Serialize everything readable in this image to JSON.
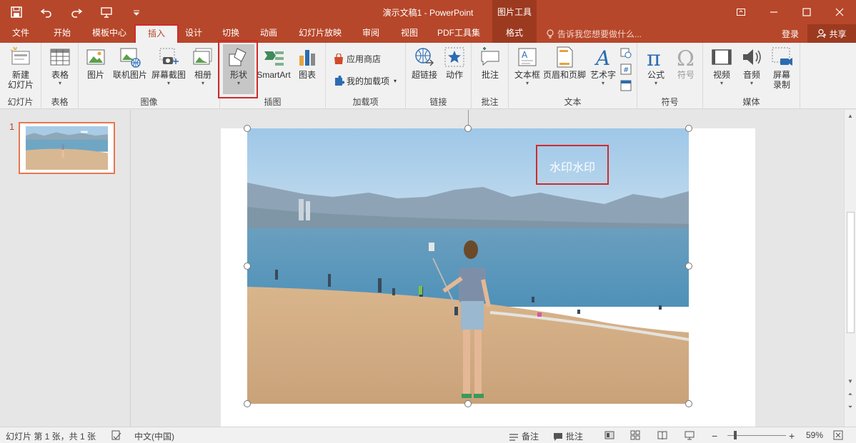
{
  "window": {
    "title": "演示文稿1 - PowerPoint",
    "context_header": "图片工具"
  },
  "qat": {
    "icons": [
      "save-icon",
      "undo-icon",
      "redo-icon",
      "present-icon",
      "customize-icon"
    ]
  },
  "tabs": [
    {
      "label": "文件"
    },
    {
      "label": "开始"
    },
    {
      "label": "模板中心"
    },
    {
      "label": "插入",
      "active": true
    },
    {
      "label": "设计"
    },
    {
      "label": "切换"
    },
    {
      "label": "动画"
    },
    {
      "label": "幻灯片放映"
    },
    {
      "label": "审阅"
    },
    {
      "label": "视图"
    },
    {
      "label": "PDF工具集"
    },
    {
      "label": "格式"
    }
  ],
  "tell_me": "告诉我您想要做什么...",
  "account": {
    "login": "登录",
    "share": "共享"
  },
  "ribbon": {
    "groups": {
      "slides": "幻灯片",
      "tables": "表格",
      "images": "图像",
      "illustrations": "插图",
      "addins": "加载项",
      "links": "链接",
      "comments": "批注",
      "text": "文本",
      "symbols": "符号",
      "media": "媒体"
    },
    "buttons": {
      "new_slide_1": "新建",
      "new_slide_2": "幻灯片",
      "table": "表格",
      "picture": "图片",
      "online_picture": "联机图片",
      "screenshot": "屏幕截图",
      "album": "相册",
      "shapes": "形状",
      "smartart": "SmartArt",
      "chart": "图表",
      "store": "应用商店",
      "my_addins": "我的加载项",
      "hyperlink": "超链接",
      "action": "动作",
      "comment": "批注",
      "textbox": "文本框",
      "header_footer": "页眉和页脚",
      "wordart": "艺术字",
      "equation": "公式",
      "symbol": "符号",
      "video": "视频",
      "audio": "音频",
      "screen_rec_1": "屏幕",
      "screen_rec_2": "录制"
    }
  },
  "thumbnails": {
    "slide_number": "1"
  },
  "slide": {
    "watermark_text": "水印水印"
  },
  "statusbar": {
    "slide_info": "幻灯片 第 1 张，共 1 张",
    "language": "中文(中国)",
    "notes": "备注",
    "comments": "批注",
    "zoom": "59%"
  }
}
